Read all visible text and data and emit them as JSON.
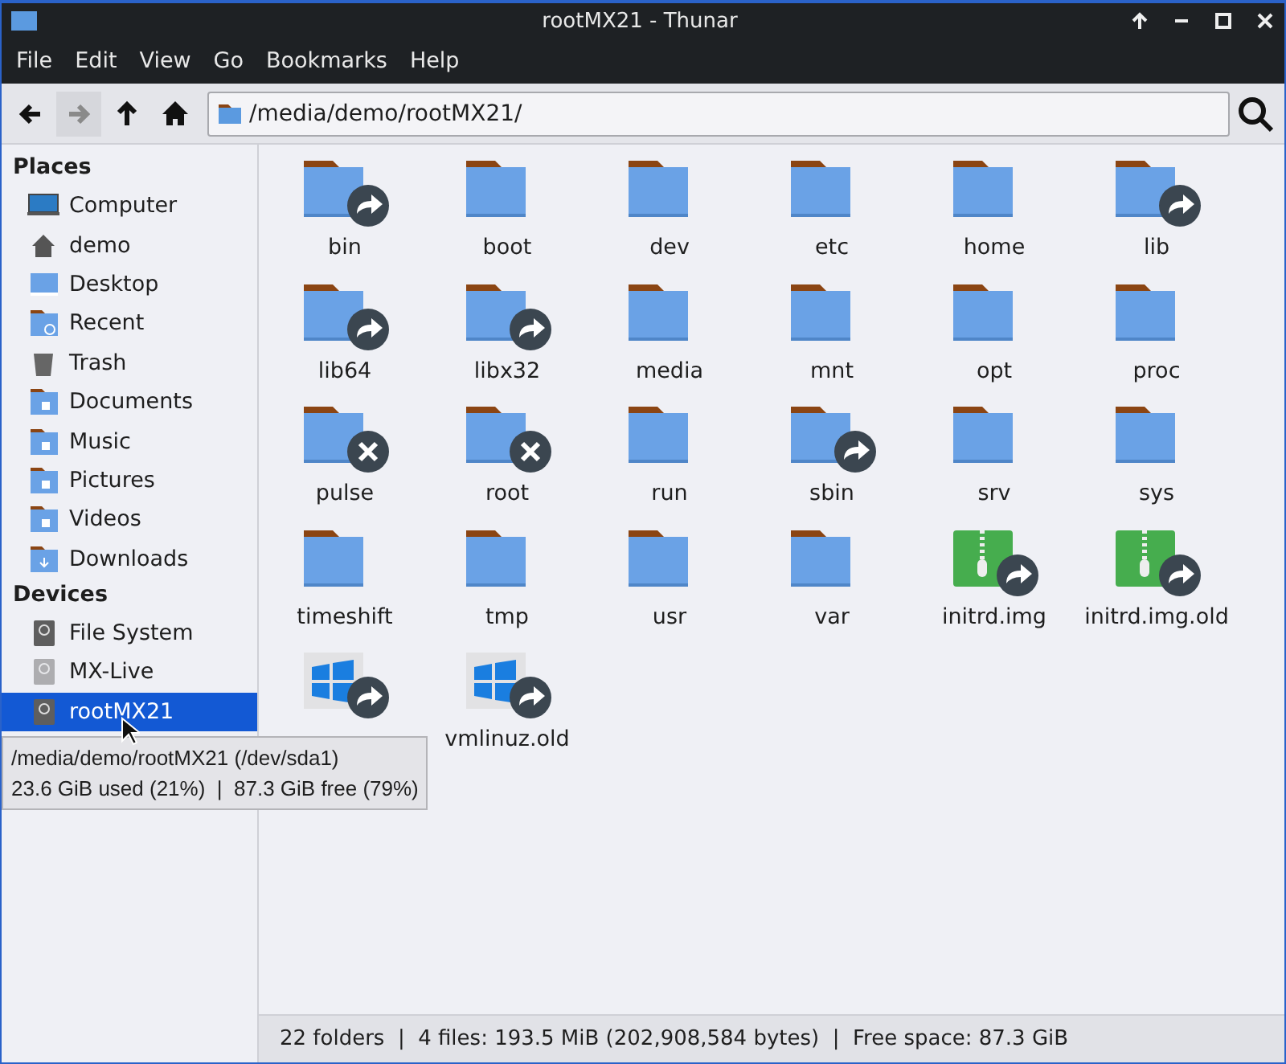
{
  "window": {
    "title": "rootMX21 - Thunar"
  },
  "menu": [
    "File",
    "Edit",
    "View",
    "Go",
    "Bookmarks",
    "Help"
  ],
  "toolbar": [
    {
      "kind": "back",
      "disabled": false
    },
    {
      "kind": "forward",
      "disabled": true
    },
    {
      "kind": "up",
      "disabled": false
    },
    {
      "kind": "home",
      "disabled": false
    }
  ],
  "location": {
    "value": "/media/demo/rootMX21/"
  },
  "sidebar": [
    {
      "heading": "Places",
      "items": [
        {
          "label": "Computer",
          "kind": "computer",
          "selected": false
        },
        {
          "label": "demo",
          "kind": "home",
          "selected": false
        },
        {
          "label": "Desktop",
          "kind": "desktop",
          "selected": false
        },
        {
          "label": "Recent",
          "kind": "recent",
          "selected": false
        },
        {
          "label": "Trash",
          "kind": "trash",
          "selected": false
        },
        {
          "label": "Documents",
          "kind": "folder",
          "selected": false
        },
        {
          "label": "Music",
          "kind": "folder",
          "selected": false
        },
        {
          "label": "Pictures",
          "kind": "folder",
          "selected": false
        },
        {
          "label": "Videos",
          "kind": "folder",
          "selected": false
        },
        {
          "label": "Downloads",
          "kind": "download",
          "selected": false
        }
      ]
    },
    {
      "heading": "Devices",
      "items": [
        {
          "label": "File System",
          "kind": "drive",
          "selected": false
        },
        {
          "label": "MX-Live",
          "kind": "drive",
          "selected": false
        },
        {
          "label": "rootMX21",
          "kind": "drive",
          "selected": true
        }
      ]
    }
  ],
  "tooltip": {
    "lines": [
      "/media/demo/rootMX21 (/dev/sda1)",
      "23.6 GiB used (21%)  |  87.3 GiB free (79%)"
    ]
  },
  "files": [
    {
      "name": "bin",
      "kind": "folderlink"
    },
    {
      "name": "boot",
      "kind": "folder"
    },
    {
      "name": "dev",
      "kind": "folder"
    },
    {
      "name": "etc",
      "kind": "folder"
    },
    {
      "name": "home",
      "kind": "folder"
    },
    {
      "name": "lib",
      "kind": "folderlink"
    },
    {
      "name": "lib64",
      "kind": "folderlink"
    },
    {
      "name": "libx32",
      "kind": "folderlink"
    },
    {
      "name": "media",
      "kind": "folder"
    },
    {
      "name": "mnt",
      "kind": "folder"
    },
    {
      "name": "opt",
      "kind": "folder"
    },
    {
      "name": "proc",
      "kind": "folder"
    },
    {
      "name": "pulse",
      "kind": "brokenlink"
    },
    {
      "name": "root",
      "kind": "brokenlink"
    },
    {
      "name": "run",
      "kind": "folder"
    },
    {
      "name": "sbin",
      "kind": "folderlink"
    },
    {
      "name": "srv",
      "kind": "folder"
    },
    {
      "name": "sys",
      "kind": "folder"
    },
    {
      "name": "timeshift",
      "kind": "folder"
    },
    {
      "name": "tmp",
      "kind": "folder"
    },
    {
      "name": "usr",
      "kind": "folder"
    },
    {
      "name": "var",
      "kind": "folder"
    },
    {
      "name": "initrd.img",
      "kind": "archive"
    },
    {
      "name": "initrd.img.old",
      "kind": "archive"
    },
    {
      "kind": "binary"
    },
    {
      "name": "vmlinuz.old",
      "kind": "binary"
    }
  ],
  "status_bar": "22 folders  |  4 files: 193.5 MiB (202,908,584 bytes)  |  Free space: 87.3 GiB"
}
